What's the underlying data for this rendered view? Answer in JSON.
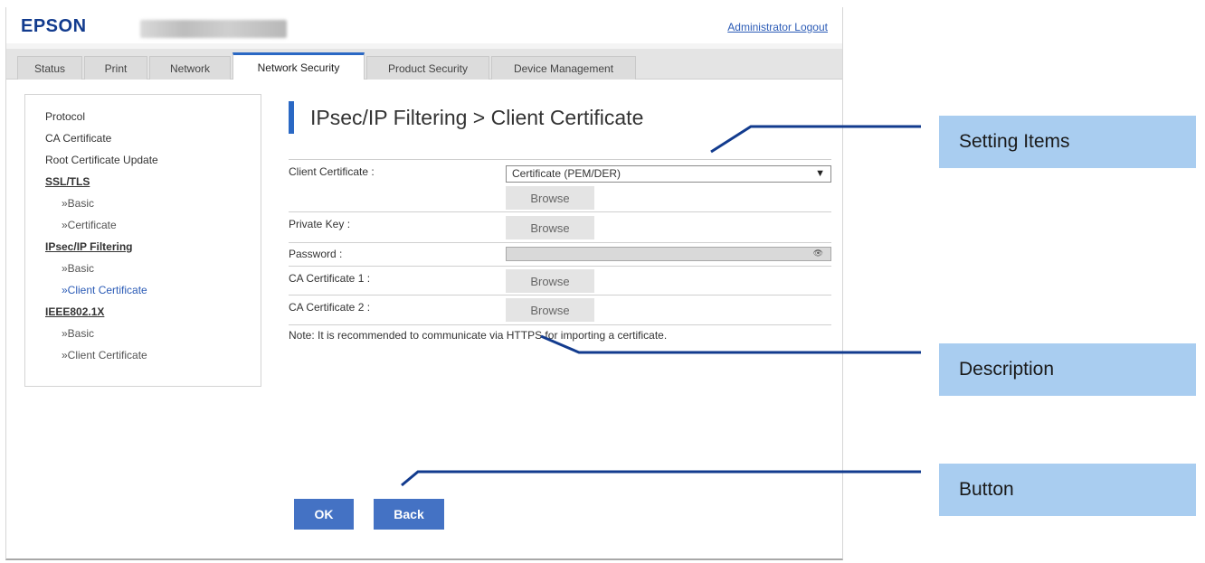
{
  "header": {
    "brand": "EPSON",
    "logout_label": "Administrator Logout"
  },
  "tabs": [
    {
      "label": "Status"
    },
    {
      "label": "Print"
    },
    {
      "label": "Network"
    },
    {
      "label": "Network Security",
      "active": true
    },
    {
      "label": "Product Security"
    },
    {
      "label": "Device Management"
    }
  ],
  "sidebar": {
    "items": [
      {
        "label": "Protocol"
      },
      {
        "label": "CA Certificate"
      },
      {
        "label": "Root Certificate Update"
      },
      {
        "label": "SSL/TLS"
      },
      {
        "label": "»Basic"
      },
      {
        "label": "»Certificate"
      },
      {
        "label": "IPsec/IP Filtering"
      },
      {
        "label": "»Basic"
      },
      {
        "label": "»Client Certificate"
      },
      {
        "label": "IEEE802.1X"
      },
      {
        "label": "»Basic"
      },
      {
        "label": "»Client Certificate"
      }
    ]
  },
  "main": {
    "title": "IPsec/IP Filtering > Client Certificate",
    "form": {
      "client_certificate_label": "Client Certificate :",
      "client_certificate_value": "Certificate (PEM/DER)",
      "private_key_label": "Private Key :",
      "password_label": "Password :",
      "ca_certificate_1_label": "CA Certificate 1 :",
      "ca_certificate_2_label": "CA Certificate 2 :",
      "browse_label": "Browse"
    },
    "note": "Note: It is recommended to communicate via HTTPS for importing a certificate.",
    "ok_label": "OK",
    "back_label": "Back"
  },
  "callouts": {
    "setting_items": "Setting Items",
    "description": "Description",
    "button": "Button"
  },
  "colors": {
    "brand": "#123b8e",
    "accent": "#2a68c4",
    "button": "#4472c4",
    "callout": "#a9cdf0"
  }
}
